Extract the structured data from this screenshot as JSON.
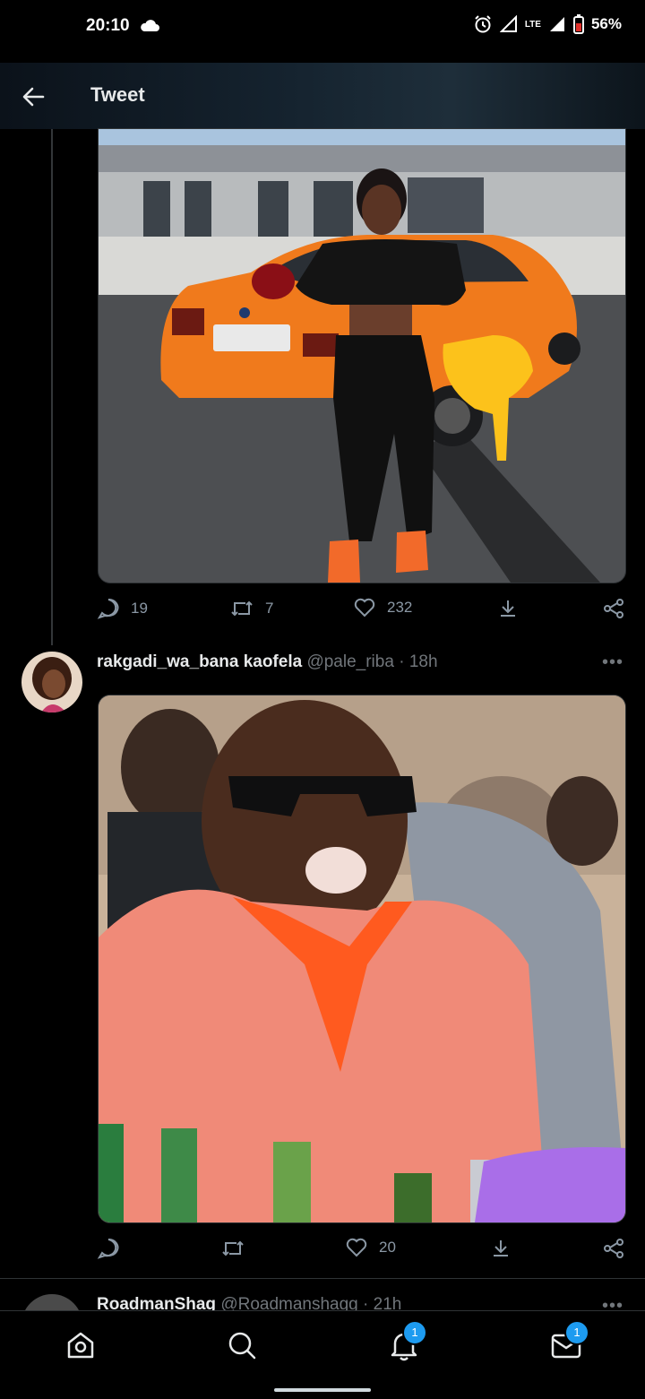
{
  "status": {
    "time": "20:10",
    "network": "LTE",
    "battery": "56%"
  },
  "header": {
    "title": "Tweet",
    "back_icon": "arrow-left-icon"
  },
  "tweets": [
    {
      "replies": "19",
      "retweets": "7",
      "likes": "232"
    },
    {
      "name": "rakgadi_wa_bana kaofela",
      "handle": "@pale_riba",
      "time": "18h",
      "replies": "",
      "retweets": "",
      "likes": "20"
    },
    {
      "name": "RoadmanShag",
      "handle": "@Roadmanshagg",
      "time": "21h"
    }
  ],
  "separator": "·",
  "nav": {
    "notifications_badge": "1",
    "messages_badge": "1"
  },
  "colors": {
    "accent": "#1d9bf0",
    "car": "#f07a1c"
  }
}
